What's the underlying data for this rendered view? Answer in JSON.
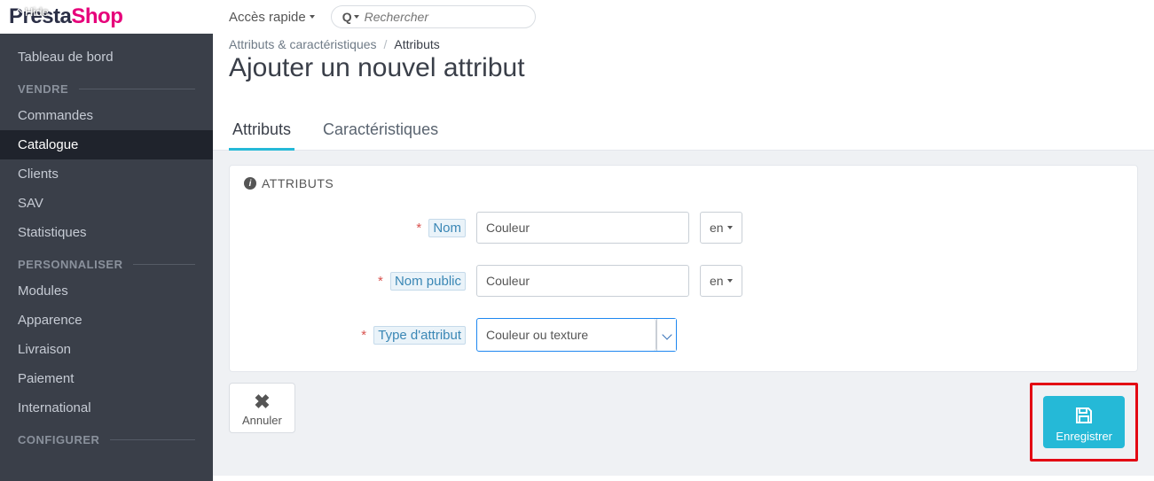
{
  "logo": {
    "brand1": "Presta",
    "brand2": "Shop",
    "hide": "Hide"
  },
  "sidebar": {
    "dashboard": "Tableau de bord",
    "group_sell": "VENDRE",
    "sell": [
      "Commandes",
      "Catalogue",
      "Clients",
      "SAV",
      "Statistiques"
    ],
    "sell_active_index": 1,
    "group_personalize": "PERSONNALISER",
    "personalize": [
      "Modules",
      "Apparence",
      "Livraison",
      "Paiement",
      "International"
    ],
    "group_configure": "CONFIGURER"
  },
  "topbar": {
    "quick_access": "Accès rapide",
    "search_label": "Q",
    "search_placeholder": "Rechercher"
  },
  "breadcrumb": {
    "parent": "Attributs & caractéristiques",
    "current": "Attributs"
  },
  "page_title": "Ajouter un nouvel attribut",
  "tabs": {
    "attributes": "Attributs",
    "features": "Caractéristiques"
  },
  "panel": {
    "heading": "ATTRIBUTS",
    "fields": {
      "name_label": "Nom",
      "name_value": "Couleur",
      "public_name_label": "Nom public",
      "public_name_value": "Couleur",
      "type_label": "Type d'attribut",
      "type_value": "Couleur ou texture",
      "lang": "en"
    }
  },
  "footer": {
    "cancel": "Annuler",
    "save": "Enregistrer"
  }
}
